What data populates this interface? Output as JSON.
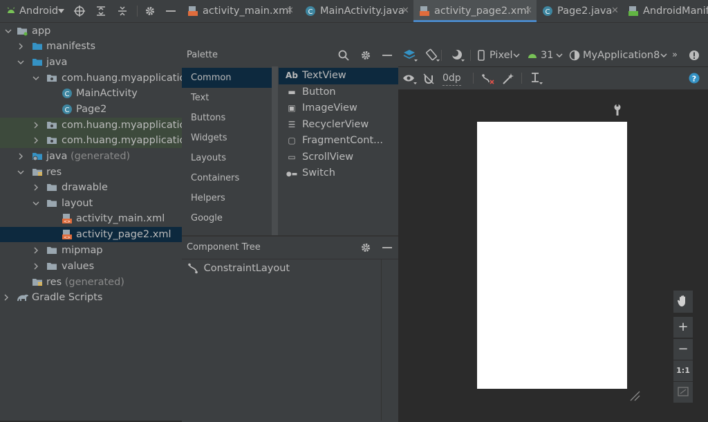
{
  "project": {
    "view_label": "Android",
    "tree": [
      {
        "label": "app",
        "dim": ""
      },
      {
        "label": "manifests",
        "dim": ""
      },
      {
        "label": "java",
        "dim": ""
      },
      {
        "label": "com.huang.myapplication",
        "dim": ""
      },
      {
        "label": "MainActivity",
        "dim": ""
      },
      {
        "label": "Page2",
        "dim": ""
      },
      {
        "label": "com.huang.myapplication",
        "dim": ""
      },
      {
        "label": "com.huang.myapplication",
        "dim": ""
      },
      {
        "label": "java",
        "dim": "(generated)"
      },
      {
        "label": "res",
        "dim": ""
      },
      {
        "label": "drawable",
        "dim": ""
      },
      {
        "label": "layout",
        "dim": ""
      },
      {
        "label": "activity_main.xml",
        "dim": ""
      },
      {
        "label": "activity_page2.xml",
        "dim": ""
      },
      {
        "label": "mipmap",
        "dim": ""
      },
      {
        "label": "values",
        "dim": ""
      },
      {
        "label": "res",
        "dim": "(generated)"
      },
      {
        "label": "Gradle Scripts",
        "dim": ""
      }
    ]
  },
  "tabs": [
    {
      "label": "activity_main.xml",
      "close": "✕"
    },
    {
      "label": "MainActivity.java",
      "close": "✕"
    },
    {
      "label": "activity_page2.xml",
      "close": "✕"
    },
    {
      "label": "Page2.java",
      "close": "✕"
    },
    {
      "label": "AndroidManif",
      "close": ""
    }
  ],
  "palette": {
    "title": "Palette",
    "categories": [
      "Common",
      "Text",
      "Buttons",
      "Widgets",
      "Layouts",
      "Containers",
      "Helpers",
      "Google"
    ],
    "widgets": [
      {
        "icon": "Ab",
        "label": "TextView"
      },
      {
        "icon": "▬",
        "label": "Button"
      },
      {
        "icon": "▣",
        "label": "ImageView"
      },
      {
        "icon": "☰",
        "label": "RecyclerView"
      },
      {
        "icon": "▢",
        "label": "FragmentCont..."
      },
      {
        "icon": "▭",
        "label": "ScrollView"
      },
      {
        "icon": "●▬",
        "label": "Switch"
      }
    ]
  },
  "component_tree": {
    "title": "Component Tree",
    "root": "ConstraintLayout"
  },
  "design_toolbar": {
    "device": "Pixel",
    "api": "31",
    "theme": "MyApplication8",
    "margin": "0dp",
    "more": "»"
  },
  "zoom": {
    "plus": "+",
    "minus": "−",
    "one_to_one": "1:1"
  },
  "colors": {
    "accent": "#4a88c7",
    "selection": "#0d293e",
    "help": "#3592c4"
  }
}
